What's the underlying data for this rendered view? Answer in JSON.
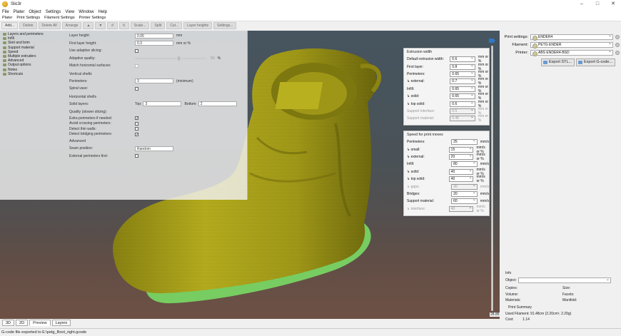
{
  "window": {
    "title": "Slic3r",
    "minimize": "–",
    "maximize": "□",
    "close": "✕"
  },
  "menu": [
    "File",
    "Plater",
    "Object",
    "Settings",
    "View",
    "Window",
    "Help"
  ],
  "tabs": [
    "Plater",
    "Print Settings",
    "Filament Settings",
    "Printer Settings"
  ],
  "toolbar": [
    "Add...",
    "Delete",
    "Delete All",
    "Arrange",
    "",
    "",
    "",
    "",
    "Scale...",
    "Split",
    "Cut...",
    "Layer heights",
    "Settings..."
  ],
  "tree": [
    {
      "label": "Layers and perimeters",
      "icon": "layers-icon"
    },
    {
      "label": "Infill",
      "icon": "infill-icon"
    },
    {
      "label": "Skirt and brim",
      "icon": "skirt-icon"
    },
    {
      "label": "Support material",
      "icon": "support-icon"
    },
    {
      "label": "Speed",
      "icon": "speed-icon"
    },
    {
      "label": "Multiple extruders",
      "icon": "extruders-icon"
    },
    {
      "label": "Advanced",
      "icon": "advanced-icon"
    },
    {
      "label": "Output options",
      "icon": "output-icon"
    },
    {
      "label": "Notes",
      "icon": "notes-icon"
    },
    {
      "label": "Shortcuts",
      "icon": "shortcuts-icon"
    }
  ],
  "layers": {
    "group": "Layer height",
    "layer_height_label": "Layer height:",
    "layer_height": "0.05",
    "layer_height_unit": "mm",
    "first_layer_label": "First layer height:",
    "first_layer": "0.3",
    "first_layer_unit": "mm or %",
    "adaptive_label": "Use adaptive slicing:",
    "adaptive_quality_label": "Adaptive quality:",
    "adaptive_quality_value": "50",
    "adaptive_quality_unit": "%",
    "match_label": "Match horizontal surfaces:"
  },
  "vertical": {
    "group": "Vertical shells",
    "perimeters_label": "Perimeters:",
    "perimeters": "3",
    "perimeters_unit": "(minimum)",
    "spiral_label": "Spiral vase:"
  },
  "horizontal": {
    "group": "Horizontal shells",
    "solid_label": "Solid layers:",
    "top_label": "Top:",
    "top": "3",
    "bottom_label": "Bottom:",
    "bottom": "2"
  },
  "quality": {
    "group": "Quality (slower slicing)",
    "items": [
      "Extra perimeters if needed:",
      "Avoid crossing perimeters:",
      "Detect thin walls:",
      "Detect bridging perimeters:"
    ],
    "checked": [
      true,
      false,
      false,
      true
    ]
  },
  "advanced": {
    "group": "Advanced",
    "seam_label": "Seam position:",
    "seam": "Random",
    "ext_first_label": "External perimeters first:"
  },
  "extrusion": {
    "title": "Extrusion width",
    "rows": [
      {
        "label": "Default extrusion width:",
        "value": "0.6",
        "unit": "mm or %",
        "disabled": false
      },
      {
        "label": "First layer:",
        "value": "0.8",
        "unit": "mm or %",
        "disabled": false
      },
      {
        "label": "Perimeters:",
        "value": "0.65",
        "unit": "mm or %",
        "disabled": false
      },
      {
        "label": "↳ external:",
        "value": "0.7",
        "unit": "mm or %",
        "disabled": false
      },
      {
        "label": "Infill:",
        "value": "0.65",
        "unit": "mm or %",
        "disabled": false
      },
      {
        "label": "↳ solid:",
        "value": "0.65",
        "unit": "mm or %",
        "disabled": false
      },
      {
        "label": "↳ top solid:",
        "value": "0.6",
        "unit": "mm or %",
        "disabled": false
      },
      {
        "label": "Support interface:",
        "value": "0.5",
        "unit": "mm or %",
        "disabled": true
      },
      {
        "label": "Support material:",
        "value": "0.45",
        "unit": "mm or %",
        "disabled": true
      }
    ]
  },
  "speed": {
    "title": "Speed for print moves",
    "rows": [
      {
        "label": "Perimeters:",
        "value": "25",
        "unit": "mm/s",
        "disabled": false
      },
      {
        "label": "↳ small:",
        "value": "15",
        "unit": "mm/s or %",
        "disabled": false
      },
      {
        "label": "↳ external:",
        "value": "20",
        "unit": "mm/s or %",
        "disabled": false
      },
      {
        "label": "Infill:",
        "value": "80",
        "unit": "mm/s",
        "disabled": false
      },
      {
        "label": "↳ solid:",
        "value": "40",
        "unit": "mm/s or %",
        "disabled": false
      },
      {
        "label": "↳ top solid:",
        "value": "40",
        "unit": "mm/s or %",
        "disabled": false
      },
      {
        "label": "↳ gaps:",
        "value": "30",
        "unit": "mm/s",
        "disabled": true
      },
      {
        "label": "Bridges:",
        "value": "20",
        "unit": "mm/s",
        "disabled": false
      },
      {
        "label": "Support material:",
        "value": "60",
        "unit": "mm/s",
        "disabled": false
      },
      {
        "label": "↳ interface:",
        "value": "40",
        "unit": "mm/s or %",
        "disabled": true
      }
    ]
  },
  "presets": {
    "print_label": "Print settings:",
    "print": "ENDER4",
    "filament_label": "Filament:",
    "filament": "PETG ENDER",
    "printer_label": "Printer:",
    "printer": "ABS ENDER4-BSD"
  },
  "export": {
    "stl": "Export STL...",
    "gcode": "Export G-code..."
  },
  "layer_slider": {
    "current_height": "28.85",
    "handle_position": 1.0
  },
  "info": {
    "title": "Info",
    "object_label": "Object:",
    "copies": "Copies:",
    "size": "Size:",
    "volume": "Volume:",
    "facets": "Facets:",
    "materials": "Materials:",
    "manifold": "Manifold:",
    "summary_title": "Print Summary",
    "filament_used": "Used Filament: 91.48cm (2.20cm³, 2.29g)",
    "cost_label": "Cost:",
    "cost": "1.14"
  },
  "view_tabs": [
    "3D",
    "2D",
    "Preview",
    "Layers"
  ],
  "status": "G-code file exported to E:\\petg_Boot_right.gcode",
  "colors": {
    "model": "#a8a018",
    "model_dark": "#6f6a0f",
    "first_layers": "#7fd86a",
    "accent": "#2e78c7"
  }
}
